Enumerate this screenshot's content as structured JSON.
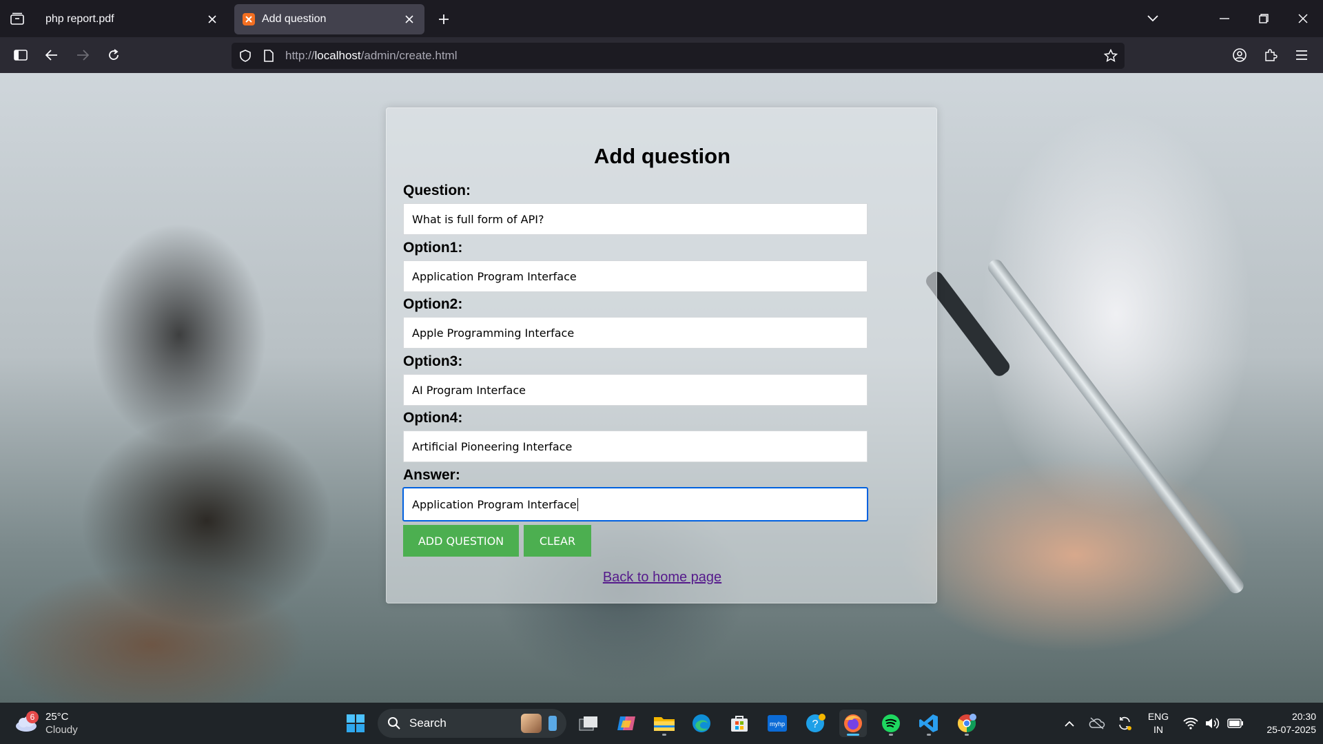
{
  "browser": {
    "tabs": [
      {
        "title": "php report.pdf",
        "active": false
      },
      {
        "title": "Add question",
        "active": true
      }
    ],
    "url_prefix": "http://",
    "url_host": "localhost",
    "url_path": "/admin/create.html"
  },
  "form": {
    "title": "Add question",
    "fields": [
      {
        "label": "Question:",
        "value": "What is full form of API?"
      },
      {
        "label": "Option1:",
        "value": "Application Program Interface"
      },
      {
        "label": "Option2:",
        "value": "Apple Programming Interface"
      },
      {
        "label": "Option3:",
        "value": "AI Program Interface"
      },
      {
        "label": "Option4:",
        "value": "Artificial Pioneering Interface"
      },
      {
        "label": "Answer:",
        "value": "Application Program Interface"
      }
    ],
    "add_button": "ADD QUESTION",
    "clear_button": "CLEAR",
    "back_link": "Back to home page"
  },
  "taskbar": {
    "weather_temp": "25°C",
    "weather_desc": "Cloudy",
    "weather_badge": "6",
    "search_label": "Search",
    "language_line1": "ENG",
    "language_line2": "IN",
    "time": "20:30",
    "date": "25-07-2025"
  },
  "colors": {
    "button_green": "#4caf50",
    "focus_blue": "#0060df",
    "link_visited": "#551a8b",
    "browser_dark": "#1c1b22"
  }
}
